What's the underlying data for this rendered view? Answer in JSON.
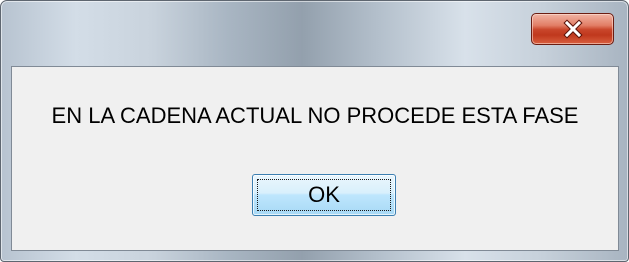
{
  "dialog": {
    "title": "",
    "close_icon": "close-icon",
    "message": "EN LA CADENA ACTUAL NO PROCEDE ESTA FASE",
    "ok_label": "OK"
  },
  "colors": {
    "close_button": "#c9462b",
    "client_background": "#f0f0f0",
    "ok_button_border": "#3c7fb1"
  }
}
